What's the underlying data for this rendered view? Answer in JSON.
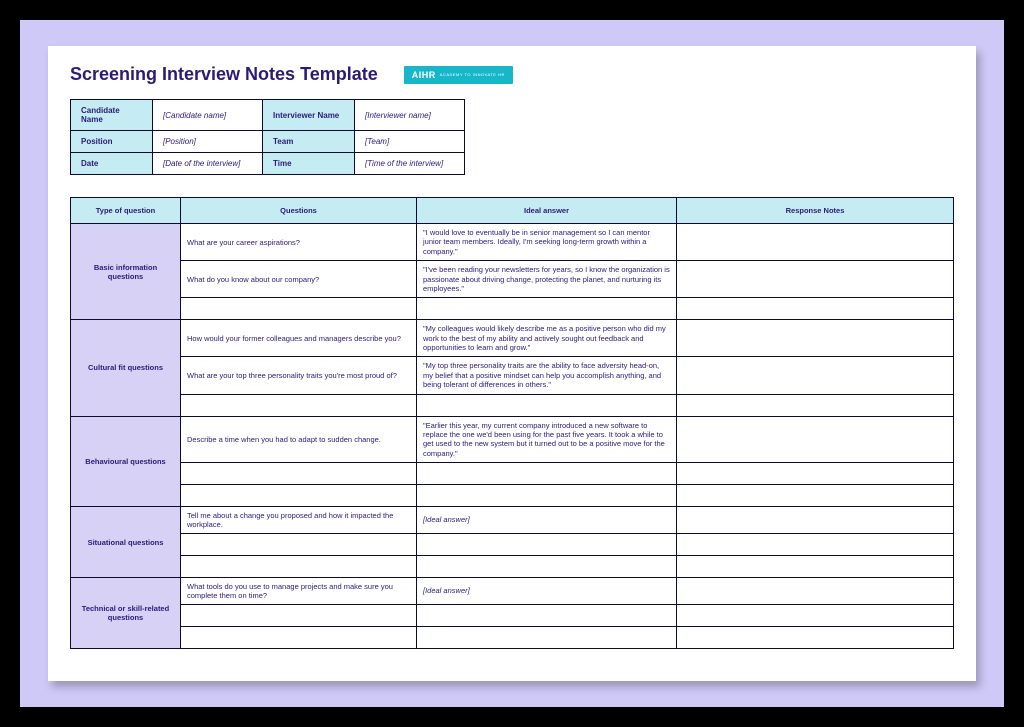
{
  "header": {
    "title": "Screening Interview Notes Template",
    "badge_main": "AIHR",
    "badge_sub": "ACADEMY TO INNOVATE HR"
  },
  "info": {
    "candidate_label": "Candidate Name",
    "candidate_val": "[Candidate name]",
    "interviewer_label": "Interviewer Name",
    "interviewer_val": "[Interviewer name]",
    "position_label": "Position",
    "position_val": "[Position]",
    "team_label": "Team",
    "team_val": "[Team]",
    "date_label": "Date",
    "date_val": "[Date of the interview]",
    "time_label": "Time",
    "time_val": "[Time of the interview]"
  },
  "columns": {
    "c1": "Type of question",
    "c2": "Questions",
    "c3": "Ideal answer",
    "c4": "Response Notes"
  },
  "sections": {
    "basic": {
      "label": "Basic information questions",
      "rows": [
        {
          "q": "What are your career aspirations?",
          "a": "\"I would love to eventually be in senior management so I can mentor junior team members. Ideally, I'm seeking long-term growth within a company.\""
        },
        {
          "q": "What do you know about our company?",
          "a": "\"I've been reading your newsletters for years, so I know the organization is passionate about driving change, protecting the planet, and nurturing its employees.\""
        },
        {
          "q": "",
          "a": ""
        }
      ]
    },
    "cultural": {
      "label": "Cultural fit questions",
      "rows": [
        {
          "q": "How would your former colleagues and managers describe you?",
          "a": "\"My colleagues would likely describe me as a positive person who did my work to the best of my ability and actively sought out feedback and opportunities to learn and grow.\""
        },
        {
          "q": "What are your top three personality traits you're most proud of?",
          "a": "\"My top three personality traits are the ability to face adversity head-on, my belief that a positive mindset can help you accomplish anything, and being tolerant of differences in others.\""
        },
        {
          "q": "",
          "a": ""
        }
      ]
    },
    "behavioural": {
      "label": "Behavioural questions",
      "rows": [
        {
          "q": "Describe a time when you had to adapt to sudden change.",
          "a": "\"Earlier this year, my current company introduced a new software to replace the one we'd been using for the past five years. It took a while to get used to the new system but it turned out to be a positive move for the company.\""
        },
        {
          "q": "",
          "a": ""
        },
        {
          "q": "",
          "a": ""
        }
      ]
    },
    "situational": {
      "label": "Situational questions",
      "rows": [
        {
          "q": "Tell me about a change you proposed and how it impacted the workplace.",
          "a": "[Ideal answer]",
          "ital": true
        },
        {
          "q": "",
          "a": ""
        },
        {
          "q": "",
          "a": ""
        }
      ]
    },
    "technical": {
      "label": "Technical or skill-related questions",
      "rows": [
        {
          "q": "What tools do you use to manage projects and make sure you complete them on time?",
          "a": "[Ideal answer]",
          "ital": true
        },
        {
          "q": "",
          "a": ""
        },
        {
          "q": "",
          "a": ""
        }
      ]
    }
  }
}
